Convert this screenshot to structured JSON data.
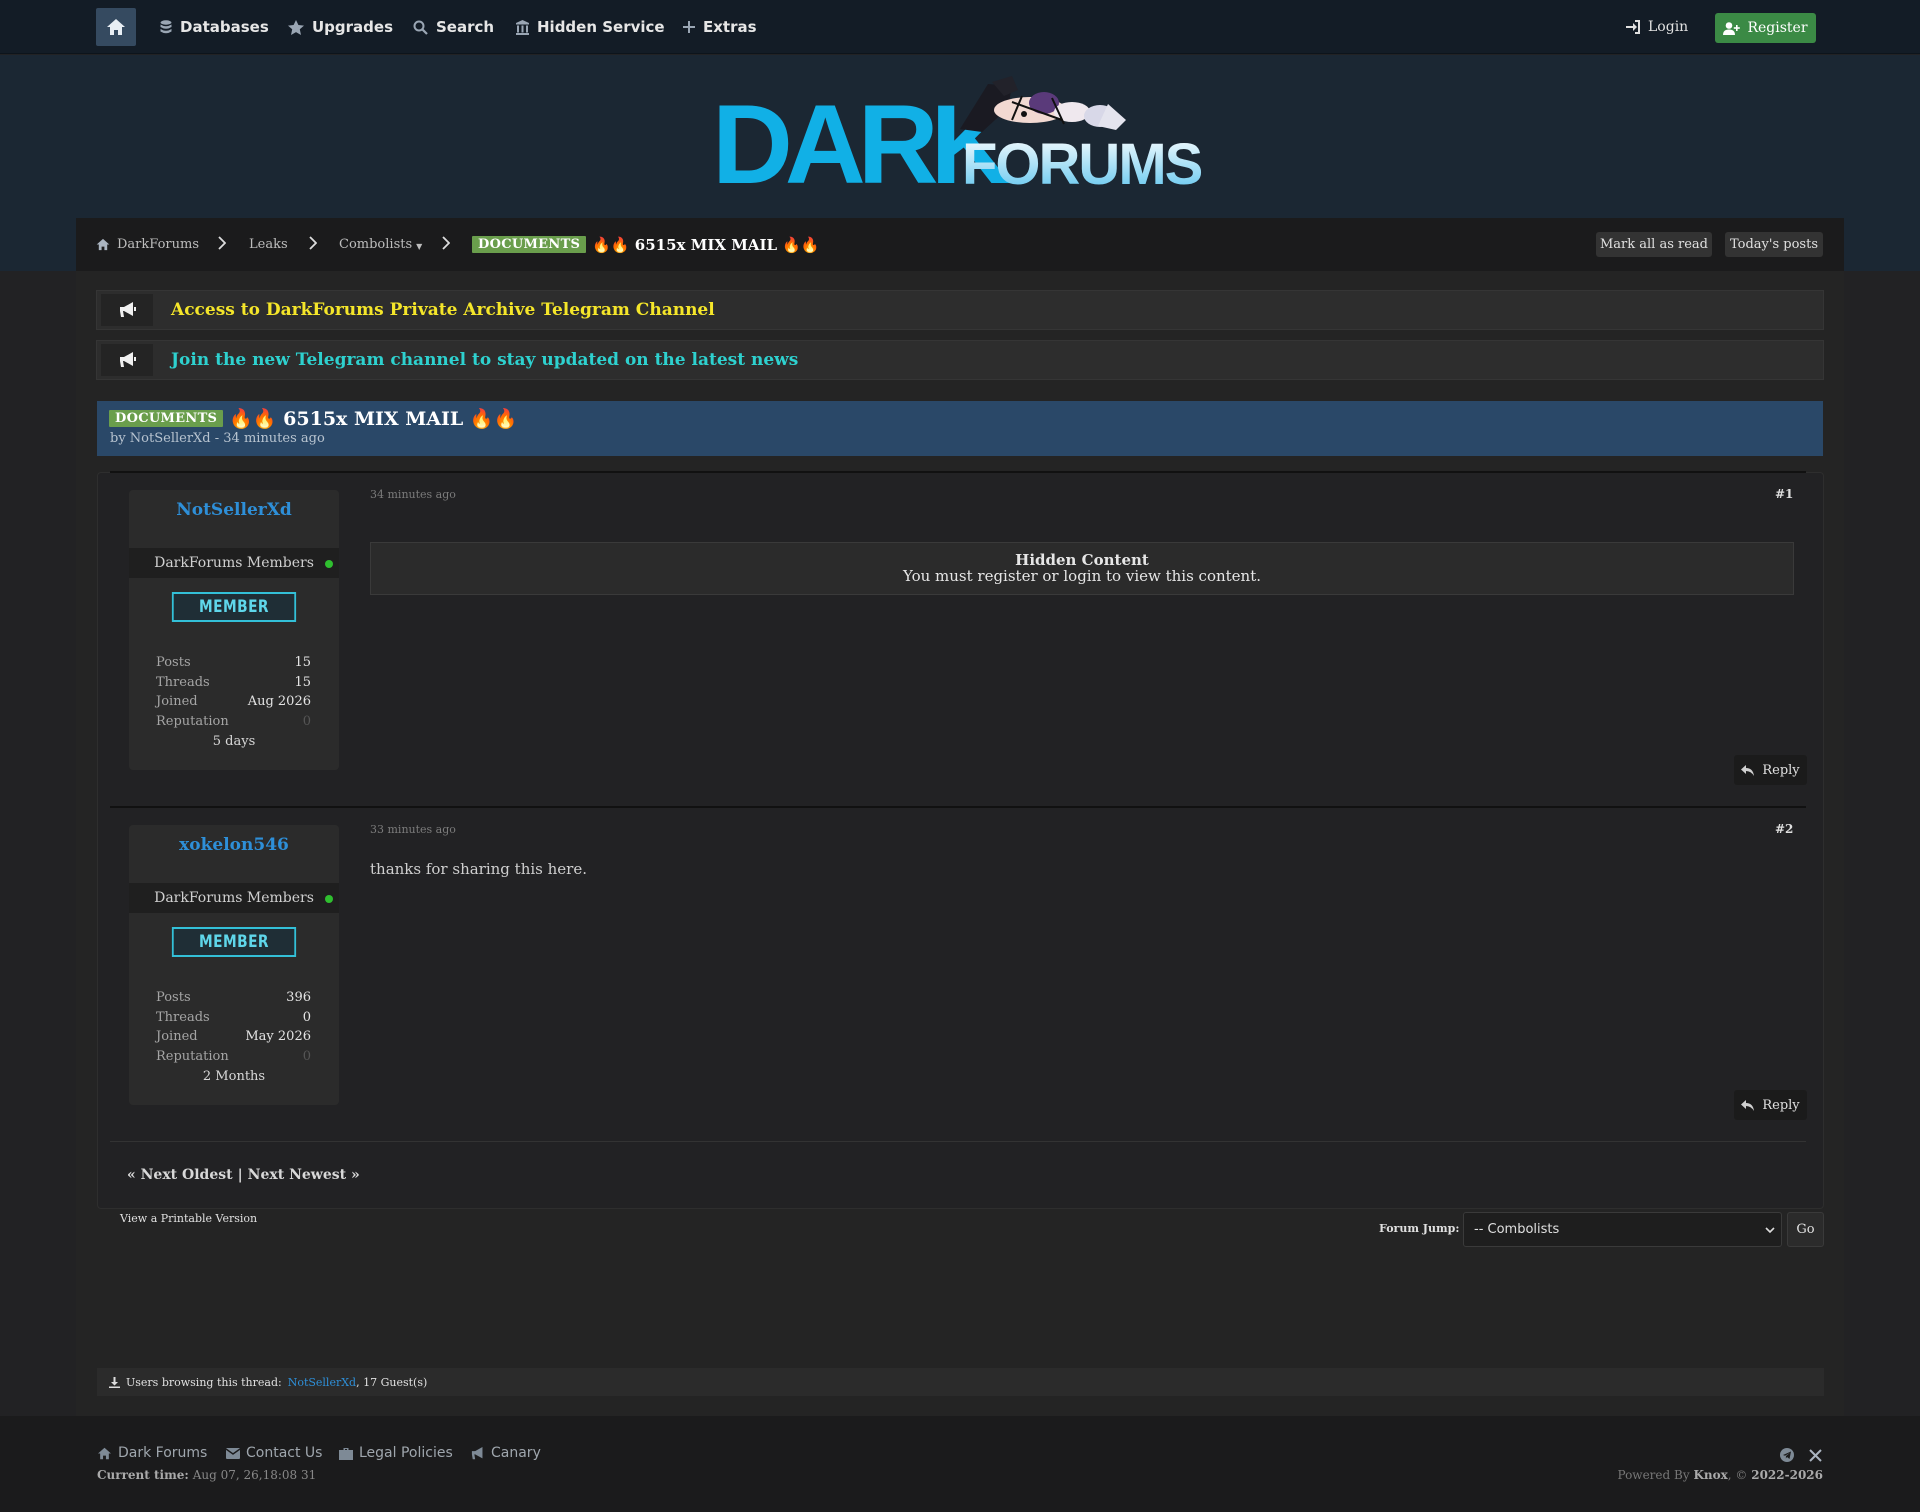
{
  "nav": {
    "items": [
      "Databases",
      "Upgrades",
      "Search",
      "Hidden Service",
      "Extras"
    ],
    "login": "Login",
    "register": "Register"
  },
  "logo": {
    "dark": "DARK",
    "forums": "FORUMS"
  },
  "breadcrumb": {
    "home": "DarkForums",
    "leaks": "Leaks",
    "combolists": "Combolists",
    "combolists_marker": "▼",
    "current_tag": "DOCUMENTS",
    "current_title": "🔥🔥 6515x MIX MAIL 🔥🔥"
  },
  "toolbar": {
    "mark_all_read": "Mark all as read",
    "todays_posts": "Today's posts"
  },
  "announcements": [
    {
      "text": "Access to DarkForums Private Archive Telegram Channel",
      "color": "#f5e62a"
    },
    {
      "text": "Join the new Telegram channel to stay updated on the latest news",
      "color": "#2ed1cf"
    }
  ],
  "thread": {
    "tag": "DOCUMENTS",
    "title": "🔥🔥 6515x MIX MAIL 🔥🔥",
    "byline": "by NotSellerXd - 34 minutes ago"
  },
  "posts": [
    {
      "username": "NotSellerXd",
      "group": "DarkForums Members",
      "badge": "MEMBER",
      "stats": {
        "posts_label": "Posts",
        "posts": "15",
        "threads_label": "Threads",
        "threads": "15",
        "joined_label": "Joined",
        "joined": "Aug 2026",
        "rep_label": "Reputation",
        "rep": "0"
      },
      "tenure": "5 days",
      "date": "34 minutes ago",
      "number": "#1",
      "hidden_title": "Hidden Content",
      "hidden_msg": "You must register or login to view this content.",
      "reply": "Reply"
    },
    {
      "username": "xokelon546",
      "group": "DarkForums Members",
      "badge": "MEMBER",
      "stats": {
        "posts_label": "Posts",
        "posts": "396",
        "threads_label": "Threads",
        "threads": "0",
        "joined_label": "Joined",
        "joined": "May 2026",
        "rep_label": "Reputation",
        "rep": "0"
      },
      "tenure": "2 Months",
      "date": "33 minutes ago",
      "number": "#2",
      "body": "thanks for sharing this here.",
      "reply": "Reply"
    }
  ],
  "pager": {
    "prev": "« Next Oldest",
    "divider": "|",
    "next": "Next Newest »"
  },
  "printable": "View a Printable Version",
  "forum_jump": {
    "label": "Forum Jump:",
    "selected": "-- Combolists",
    "go": "Go"
  },
  "browsing": {
    "label": "Users browsing this thread:",
    "user": "NotSellerXd",
    "guests": ", 17 Guest(s)"
  },
  "footer": {
    "links": [
      "Dark Forums",
      "Contact Us",
      "Legal Policies",
      "Canary"
    ],
    "current_time_label": "Current time:",
    "current_time": "Aug 07, 26,18:08 31",
    "powered_prefix": "Powered By",
    "powered_name": "Knox",
    "powered_suffix": ", ©",
    "years": "2022-2026"
  },
  "colors": {
    "accent": "#2e8fd8",
    "tag": "#6a9e4c",
    "register": "#3b8a45",
    "thread_header": "#2a4868"
  }
}
